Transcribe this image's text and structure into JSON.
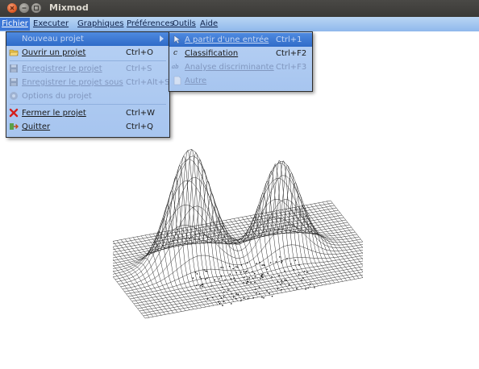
{
  "window": {
    "title": "Mixmod"
  },
  "menubar": {
    "fichier": "Fichier",
    "executer": "Executer",
    "graphiques": "Graphiques",
    "preferences": "Préférences",
    "outils": "Outils",
    "aide": "Aide"
  },
  "fichier_menu": {
    "nouveau": "Nouveau projet",
    "ouvrir": "Ouvrir un projet",
    "ouvrir_shortcut": "Ctrl+O",
    "enregistrer": "Enregistrer le projet",
    "enregistrer_shortcut": "Ctrl+S",
    "enregistrer_sous": "Enregistrer le projet sous",
    "enregistrer_sous_shortcut": "Ctrl+Alt+S",
    "options": "Options du projet",
    "fermer": "Fermer le projet",
    "fermer_shortcut": "Ctrl+W",
    "quitter": "Quitter",
    "quitter_shortcut": "Ctrl+Q"
  },
  "outils_menu": {
    "partir": "A partir d'une entrée",
    "partir_shortcut": "Ctrl+1",
    "classification": "Classification",
    "classification_shortcut": "Ctrl+F2",
    "analyse": "Analyse discriminante",
    "analyse_shortcut": "Ctrl+F3",
    "autre": "Autre"
  },
  "colors": {
    "menu_bg": "#b6d0f4",
    "highlight": "#3d77d6",
    "titlebar": "#3c3b37",
    "close_button": "#e0622a"
  },
  "icons": {
    "ouvrir": "folder-open-icon",
    "enregistrer": "save-icon",
    "enregistrer_sous": "save-as-icon",
    "options": "settings-icon",
    "fermer": "close-x-icon",
    "quitter": "exit-icon",
    "partir": "cursor-icon",
    "classification": "classification-c-icon",
    "analyse": "discriminant-icon",
    "autre": "document-icon"
  }
}
